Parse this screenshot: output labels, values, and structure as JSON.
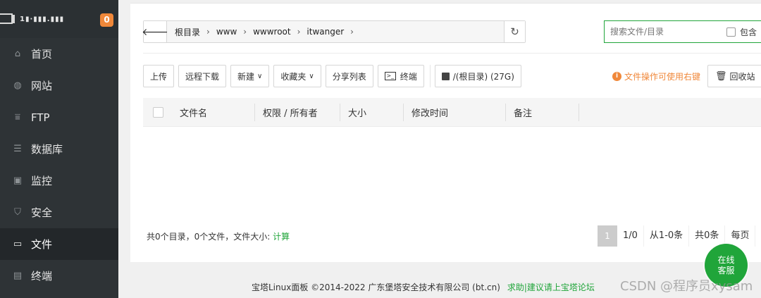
{
  "sidebar": {
    "server_ip": "1▮·▮▮▮.▮▮▮",
    "badge_count": "0",
    "items": [
      {
        "label": "首页",
        "icon": "home-icon"
      },
      {
        "label": "网站",
        "icon": "globe-icon"
      },
      {
        "label": "FTP",
        "icon": "ftp-icon"
      },
      {
        "label": "数据库",
        "icon": "database-icon"
      },
      {
        "label": "监控",
        "icon": "monitor-icon"
      },
      {
        "label": "安全",
        "icon": "shield-icon"
      },
      {
        "label": "文件",
        "icon": "folder-icon",
        "active": true
      },
      {
        "label": "终端",
        "icon": "terminal-icon"
      }
    ]
  },
  "path": {
    "crumbs": [
      "根目录",
      "www",
      "wwwroot",
      "itwanger"
    ],
    "sep": "›"
  },
  "search": {
    "placeholder": "搜索文件/目录",
    "include_sub_label": "包含"
  },
  "toolbar": {
    "upload": "上传",
    "remote_download": "远程下载",
    "new": "新建",
    "favorites": "收藏夹",
    "share_list": "分享列表",
    "terminal": "终端",
    "disk": "/(根目录) (27G)"
  },
  "tip": "文件操作可使用右键",
  "recycle": "回收站",
  "table": {
    "columns": [
      "文件名",
      "权限 / 所有者",
      "大小",
      "修改时间",
      "备注"
    ]
  },
  "stats": {
    "text": "共0个目录，0个文件，文件大小:",
    "calc": "计算"
  },
  "pager": {
    "current": "1",
    "page": "1/0",
    "range": "从1-0条",
    "total": "共0条",
    "per_page": "每页"
  },
  "footer": {
    "copyright": "宝塔Linux面板 ©2014-2022 广东堡塔安全技术有限公司 (bt.cn)",
    "help": "求助|建议请上宝塔论坛"
  },
  "support": {
    "line1": "在线",
    "line2": "客服"
  },
  "watermark": "CSDN @程序员xysam",
  "colors": {
    "accent": "#20a53a",
    "warning": "#f0883a",
    "sidebar": "#2e3336"
  }
}
